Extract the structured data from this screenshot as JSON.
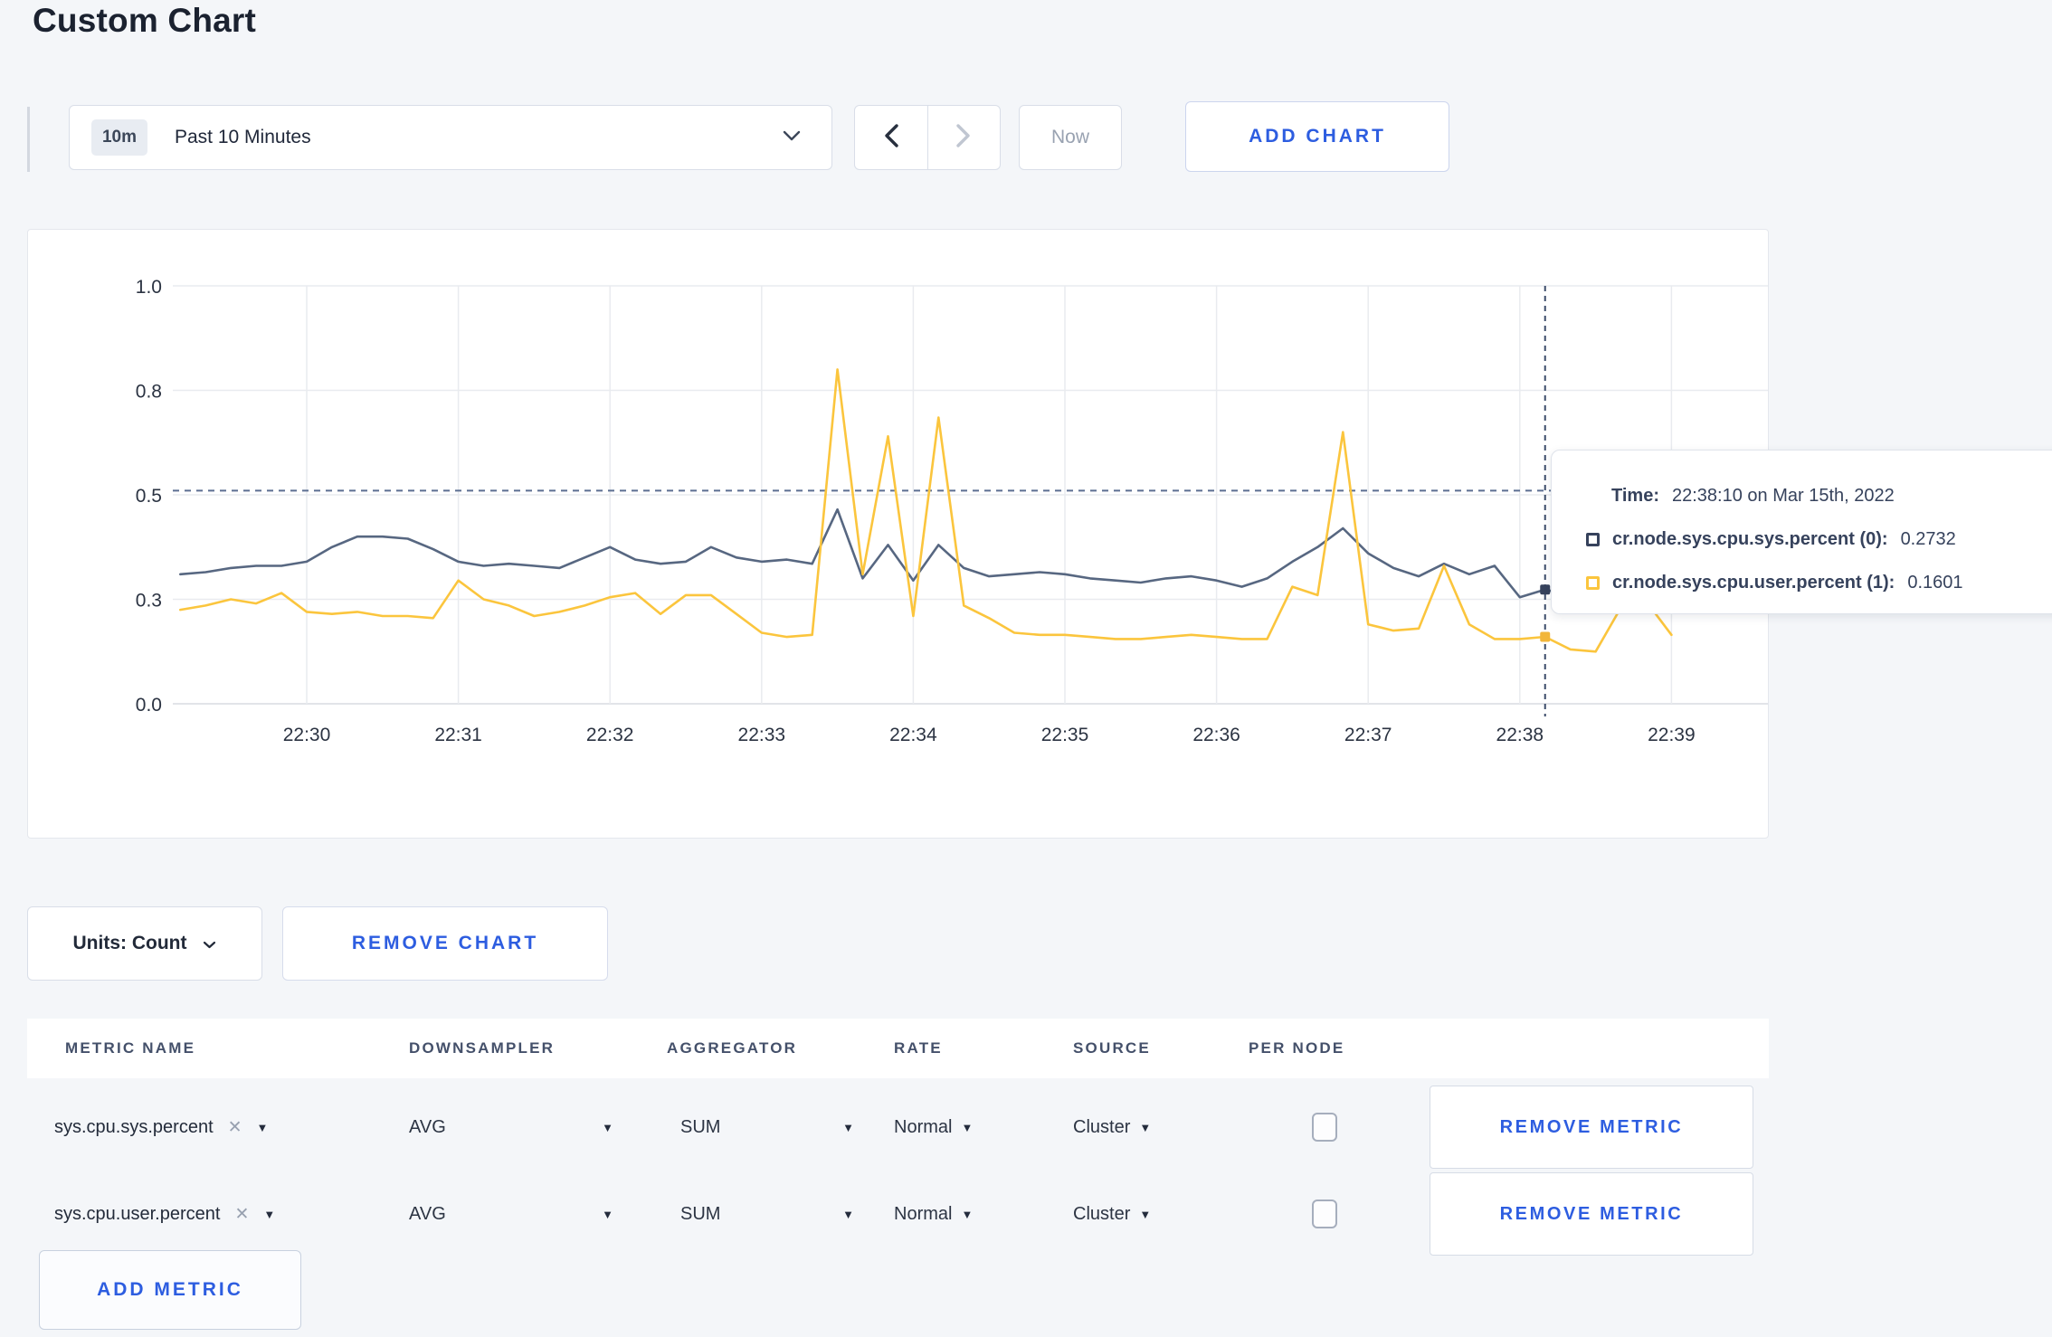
{
  "page": {
    "title": "Custom Chart"
  },
  "toolbar": {
    "time_window_badge": "10m",
    "time_window_label": "Past 10 Minutes",
    "now_label": "Now",
    "add_chart_label": "ADD CHART"
  },
  "chart_data": {
    "type": "line",
    "title": "",
    "x_start_time": "22:29:10",
    "x_step_seconds": 10,
    "x_tick_labels": [
      "22:30",
      "22:31",
      "22:32",
      "22:33",
      "22:34",
      "22:35",
      "22:36",
      "22:37",
      "22:38",
      "22:39"
    ],
    "y_ticks": [
      {
        "value": 0.0,
        "label": "0.0"
      },
      {
        "value": 0.25,
        "label": "0.3"
      },
      {
        "value": 0.5,
        "label": "0.5"
      },
      {
        "value": 0.75,
        "label": "0.8"
      },
      {
        "value": 1.0,
        "label": "1.0"
      }
    ],
    "ylim": [
      0,
      1
    ],
    "grid": true,
    "legend_position": "tooltip",
    "series": [
      {
        "name": "cr.node.sys.cpu.sys.percent",
        "color": "#576781",
        "dot_color": "#36425c",
        "values": [
          0.31,
          0.315,
          0.325,
          0.33,
          0.33,
          0.34,
          0.375,
          0.4,
          0.4,
          0.395,
          0.37,
          0.34,
          0.33,
          0.335,
          0.33,
          0.325,
          0.35,
          0.375,
          0.345,
          0.335,
          0.34,
          0.375,
          0.35,
          0.34,
          0.345,
          0.335,
          0.465,
          0.3,
          0.38,
          0.295,
          0.38,
          0.325,
          0.305,
          0.31,
          0.315,
          0.31,
          0.3,
          0.295,
          0.29,
          0.3,
          0.305,
          0.295,
          0.28,
          0.3,
          0.34,
          0.375,
          0.42,
          0.36,
          0.325,
          0.305,
          0.335,
          0.31,
          0.33,
          0.255,
          0.2732,
          0.26,
          0.285,
          0.29,
          0.285,
          0.3
        ]
      },
      {
        "name": "cr.node.sys.cpu.user.percent",
        "color": "#fbc53d",
        "dot_color": "#f2b63a",
        "values": [
          0.225,
          0.235,
          0.25,
          0.24,
          0.265,
          0.22,
          0.215,
          0.22,
          0.21,
          0.21,
          0.205,
          0.295,
          0.25,
          0.235,
          0.21,
          0.22,
          0.235,
          0.255,
          0.265,
          0.215,
          0.26,
          0.26,
          0.215,
          0.17,
          0.16,
          0.165,
          0.8,
          0.31,
          0.64,
          0.21,
          0.685,
          0.235,
          0.205,
          0.17,
          0.165,
          0.165,
          0.16,
          0.155,
          0.155,
          0.16,
          0.165,
          0.16,
          0.155,
          0.155,
          0.28,
          0.26,
          0.65,
          0.19,
          0.175,
          0.18,
          0.33,
          0.19,
          0.155,
          0.155,
          0.1601,
          0.13,
          0.125,
          0.23,
          0.245,
          0.165
        ]
      }
    ],
    "crosshair": {
      "time": "22:38:10",
      "point_index": 54,
      "guide_value": 0.51,
      "values": {
        "sys": 0.2732,
        "user": 0.1601
      }
    }
  },
  "tooltip": {
    "time_label": "Time:",
    "time_value": "22:38:10 on Mar 15th, 2022",
    "rows": [
      {
        "label": "cr.node.sys.cpu.sys.percent (0):",
        "value": "0.2732",
        "color": "#36425c"
      },
      {
        "label": "cr.node.sys.cpu.user.percent (1):",
        "value": "0.1601",
        "color": "#fbc53d"
      }
    ]
  },
  "chart_footer": {
    "units_label": "Units: Count",
    "remove_chart_label": "REMOVE CHART"
  },
  "metrics_table": {
    "headers": [
      "METRIC NAME",
      "DOWNSAMPLER",
      "AGGREGATOR",
      "RATE",
      "SOURCE",
      "PER NODE"
    ],
    "rows": [
      {
        "metric": "sys.cpu.sys.percent",
        "downsampler": "AVG",
        "aggregator": "SUM",
        "rate": "Normal",
        "source": "Cluster",
        "per_node_checked": false,
        "remove_label": "REMOVE METRIC"
      },
      {
        "metric": "sys.cpu.user.percent",
        "downsampler": "AVG",
        "aggregator": "SUM",
        "rate": "Normal",
        "source": "Cluster",
        "per_node_checked": false,
        "remove_label": "REMOVE METRIC"
      }
    ],
    "add_metric_label": "ADD METRIC"
  }
}
